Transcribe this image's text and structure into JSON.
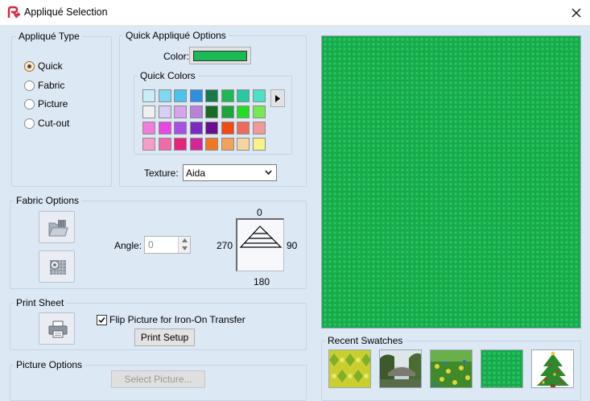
{
  "window": {
    "title": "Appliqué Selection"
  },
  "applique_type": {
    "legend": "Appliqué Type",
    "options": [
      {
        "label": "Quick",
        "checked": true
      },
      {
        "label": "Fabric",
        "checked": false
      },
      {
        "label": "Picture",
        "checked": false
      },
      {
        "label": "Cut-out",
        "checked": false
      }
    ]
  },
  "quick_options": {
    "legend": "Quick Appliqué  Options",
    "color_label": "Color:",
    "color_value": "#1db954",
    "quick_colors_legend": "Quick Colors",
    "palette": [
      [
        "#c8eef8",
        "#7fd8f0",
        "#49c4ec",
        "#2d8fe0",
        "#167a4a",
        "#1db954",
        "#26c9a0",
        "#4de0c8"
      ],
      [
        "#f0f0f0",
        "#d8cff4",
        "#d6a4e8",
        "#b882d8",
        "#176b22",
        "#1ea43a",
        "#22dd22",
        "#77e855"
      ],
      [
        "#f27cd8",
        "#ec45e6",
        "#a94ee6",
        "#7a2ac0",
        "#6a0e90",
        "#f24a10",
        "#f06a5a",
        "#f29a9a"
      ],
      [
        "#f59fc8",
        "#f06aa8",
        "#e6257a",
        "#d4249a",
        "#f07820",
        "#f2a25a",
        "#f7d5a0",
        "#f7f28a"
      ]
    ],
    "texture_label": "Texture:",
    "texture_value": "Aida"
  },
  "fabric_options": {
    "legend": "Fabric Options",
    "angle_label": "Angle:",
    "angle_value": "0",
    "compass": {
      "top": "0",
      "left": "270",
      "right": "90",
      "bottom": "180"
    }
  },
  "print_sheet": {
    "legend": "Print Sheet",
    "flip_label": "Flip Picture for Iron-On Transfer",
    "flip_checked": true,
    "print_setup_label": "Print Setup"
  },
  "picture_options": {
    "legend": "Picture Options",
    "select_picture_label": "Select Picture..."
  },
  "preview": {
    "fabric_color": "#1db954"
  },
  "recent_swatches": {
    "legend": "Recent Swatches",
    "items": [
      {
        "icon": "yellow-pattern-swatch"
      },
      {
        "icon": "bridge-photo-swatch"
      },
      {
        "icon": "flowers-photo-swatch"
      },
      {
        "icon": "green-aida-swatch"
      },
      {
        "icon": "christmas-tree-swatch"
      }
    ]
  }
}
